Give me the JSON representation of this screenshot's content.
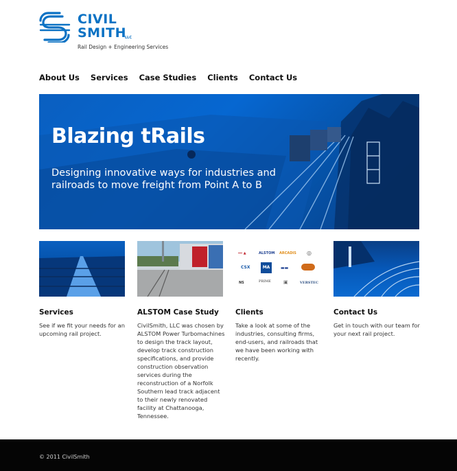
{
  "brand": {
    "name_line1": "CIVIL",
    "name_line2": "SMITH",
    "llc": "LLC",
    "tagline": "Rail Design + Engineering Services",
    "color": "#0b72c4"
  },
  "nav": {
    "items": [
      "About Us",
      "Services",
      "Case Studies",
      "Clients",
      "Contact Us"
    ]
  },
  "hero": {
    "title": "Blazing tRails",
    "subtitle": "Designing innovative ways for industries and railroads to move freight from Point A to B",
    "color": "#0667d1"
  },
  "columns": [
    {
      "title": "Services",
      "text": "See if we fit your needs for an upcoming rail project."
    },
    {
      "title": "ALSTOM Case Study",
      "text": "CivilSmith, LLC was chosen by ALSTOM Power Turbomachines to design the track layout, develop track construction specifications, and provide construction observation services during the reconstruction of a Norfolk Southern lead track adjacent to their newly renovated facility at Chattanooga, Tennessee."
    },
    {
      "title": "Clients",
      "text": "Take a look at some of the industries, consulting firms, end-users, and railroads that we have been working with recently."
    },
    {
      "title": "Contact Us",
      "text": "Get in touch with our team for your next rail project."
    }
  ],
  "client_logos": [
    "ALSTOM",
    "ARCADIS",
    "CSX",
    "MA",
    "NS",
    "PRIME",
    "VERSTEC"
  ],
  "footer": {
    "copyright": "© 2011 CivilSmith"
  }
}
